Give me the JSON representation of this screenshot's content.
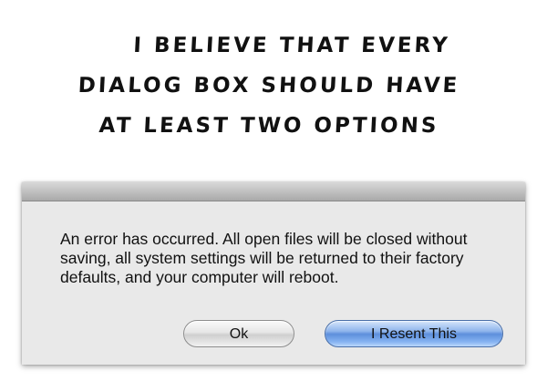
{
  "comic": {
    "caption_lines": [
      "I believe that every",
      "dialog box should have",
      "at least two options"
    ]
  },
  "dialog": {
    "message": "An error has occurred. All open files will be closed without saving, all system settings will be returned to their factory defaults, and your computer will reboot.",
    "buttons": {
      "ok_label": "Ok",
      "resent_label": "I Resent This"
    }
  }
}
